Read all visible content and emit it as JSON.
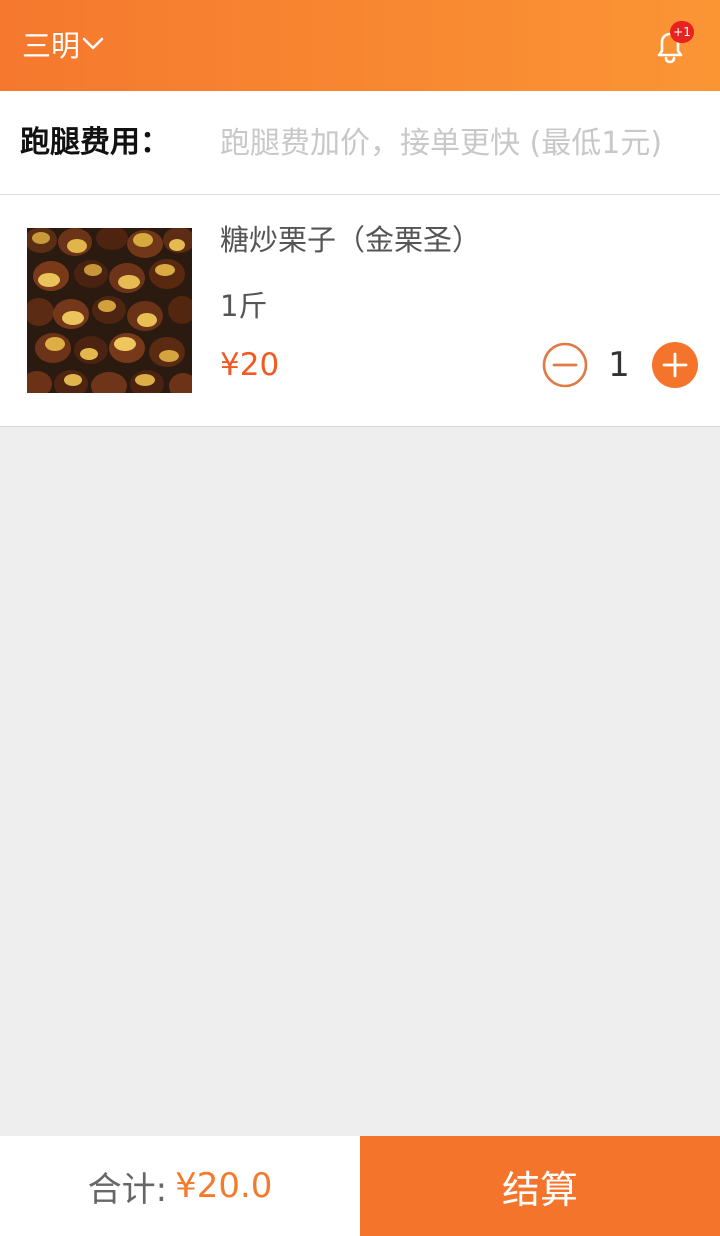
{
  "header": {
    "city": "三明",
    "notification_badge": "+1"
  },
  "fee": {
    "label": "跑腿费用：",
    "placeholder": "跑腿费加价，接单更快 (最低1元)",
    "value": ""
  },
  "product": {
    "name": "糖炒栗子（金栗圣）",
    "spec": "1斤",
    "price": "¥20",
    "quantity": "1"
  },
  "footer": {
    "total_label": "合计:",
    "total_value": "¥20.0",
    "checkout_label": "结算"
  },
  "colors": {
    "accent": "#f5742b",
    "price": "#f15a22",
    "badge": "#e8231f"
  },
  "icons": {
    "city_dropdown": "chevron-down-icon",
    "notification": "bell-icon",
    "decrease": "minus-circle-icon",
    "increase": "plus-circle-icon"
  }
}
